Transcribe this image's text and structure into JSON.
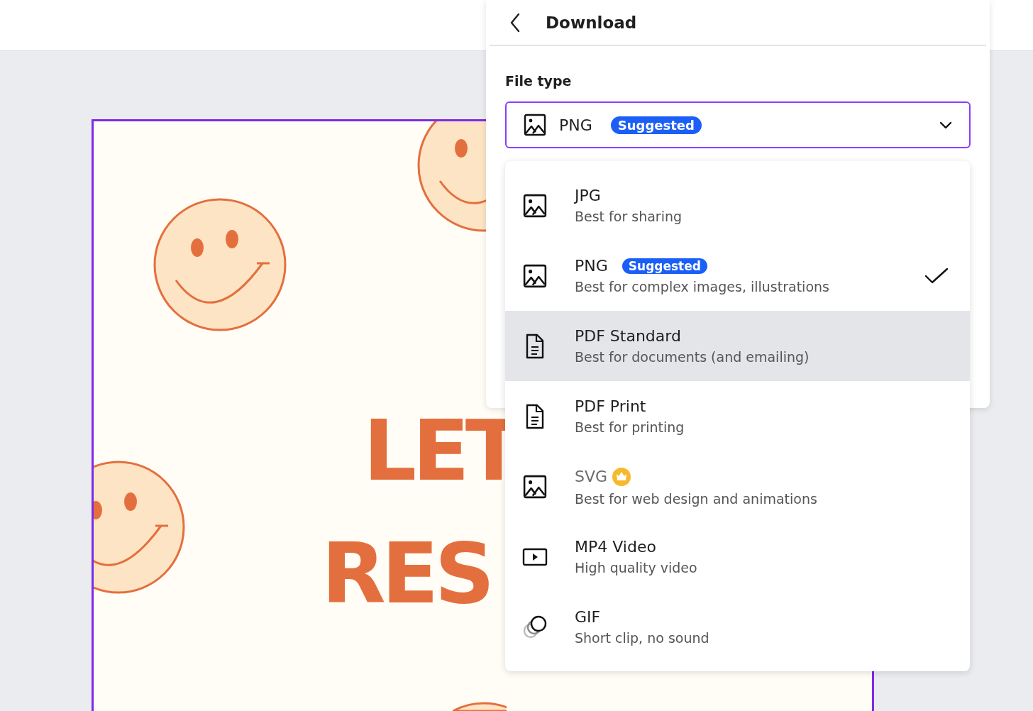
{
  "design": {
    "lines": [
      "LET",
      "RES"
    ]
  },
  "panel": {
    "title": "Download",
    "file_type_label": "File type",
    "file_type": {
      "value": "PNG",
      "badge": "Suggested",
      "kind": "image"
    },
    "options": [
      {
        "kind": "image",
        "title": "JPG",
        "description": "Best for sharing",
        "selected": false,
        "highlighted": false,
        "premium": false
      },
      {
        "kind": "image",
        "title": "PNG",
        "badge": "Suggested",
        "description": "Best for complex images, illustrations",
        "selected": true,
        "highlighted": false,
        "premium": false
      },
      {
        "kind": "document",
        "title": "PDF Standard",
        "description": "Best for documents (and emailing)",
        "selected": false,
        "highlighted": true,
        "premium": false
      },
      {
        "kind": "document",
        "title": "PDF Print",
        "description": "Best for printing",
        "selected": false,
        "highlighted": false,
        "premium": false
      },
      {
        "kind": "image",
        "title": "SVG",
        "description": "Best for web design and animations",
        "selected": false,
        "highlighted": false,
        "premium": true
      },
      {
        "kind": "video",
        "title": "MP4 Video",
        "description": "High quality video",
        "selected": false,
        "highlighted": false,
        "premium": false
      },
      {
        "kind": "gif",
        "title": "GIF",
        "description": "Short clip, no sound",
        "selected": false,
        "highlighted": false,
        "premium": false
      }
    ]
  }
}
